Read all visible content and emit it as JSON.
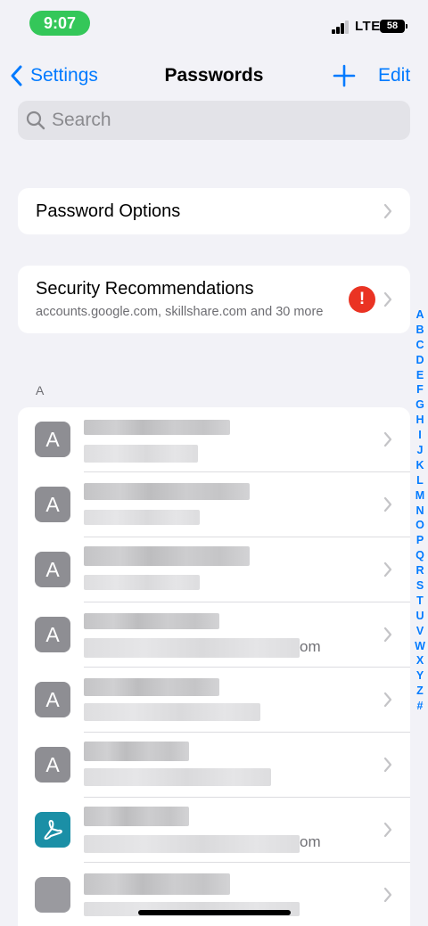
{
  "status": {
    "time": "9:07",
    "network": "LTE",
    "battery": "58"
  },
  "nav": {
    "back_label": "Settings",
    "title": "Passwords",
    "edit_label": "Edit"
  },
  "search": {
    "placeholder": "Search"
  },
  "password_options": {
    "label": "Password Options"
  },
  "security": {
    "title": "Security Recommendations",
    "subtitle": "accounts.google.com, skillshare.com and 30 more",
    "badge": "!"
  },
  "section_letter": "A",
  "rows": [
    {
      "icon_letter": "A",
      "icon": "letter-icon"
    },
    {
      "icon_letter": "A",
      "icon": "letter-icon"
    },
    {
      "icon_letter": "A",
      "icon": "letter-icon"
    },
    {
      "icon_letter": "A",
      "icon": "letter-icon",
      "visible_suffix": "om"
    },
    {
      "icon_letter": "A",
      "icon": "letter-icon"
    },
    {
      "icon_letter": "A",
      "icon": "letter-icon"
    },
    {
      "icon_letter": "",
      "icon": "acrobat-icon",
      "visible_suffix": "om"
    },
    {
      "icon_letter": "",
      "icon": "blank-icon"
    }
  ],
  "index_letters": [
    "A",
    "B",
    "C",
    "D",
    "E",
    "F",
    "G",
    "H",
    "I",
    "J",
    "K",
    "L",
    "M",
    "N",
    "O",
    "P",
    "Q",
    "R",
    "S",
    "T",
    "U",
    "V",
    "W",
    "X",
    "Y",
    "Z",
    "#"
  ],
  "colors": {
    "accent": "#007aff",
    "alert": "#ea3323",
    "time_pill": "#34c759",
    "acrobat": "#1b8fa6"
  }
}
